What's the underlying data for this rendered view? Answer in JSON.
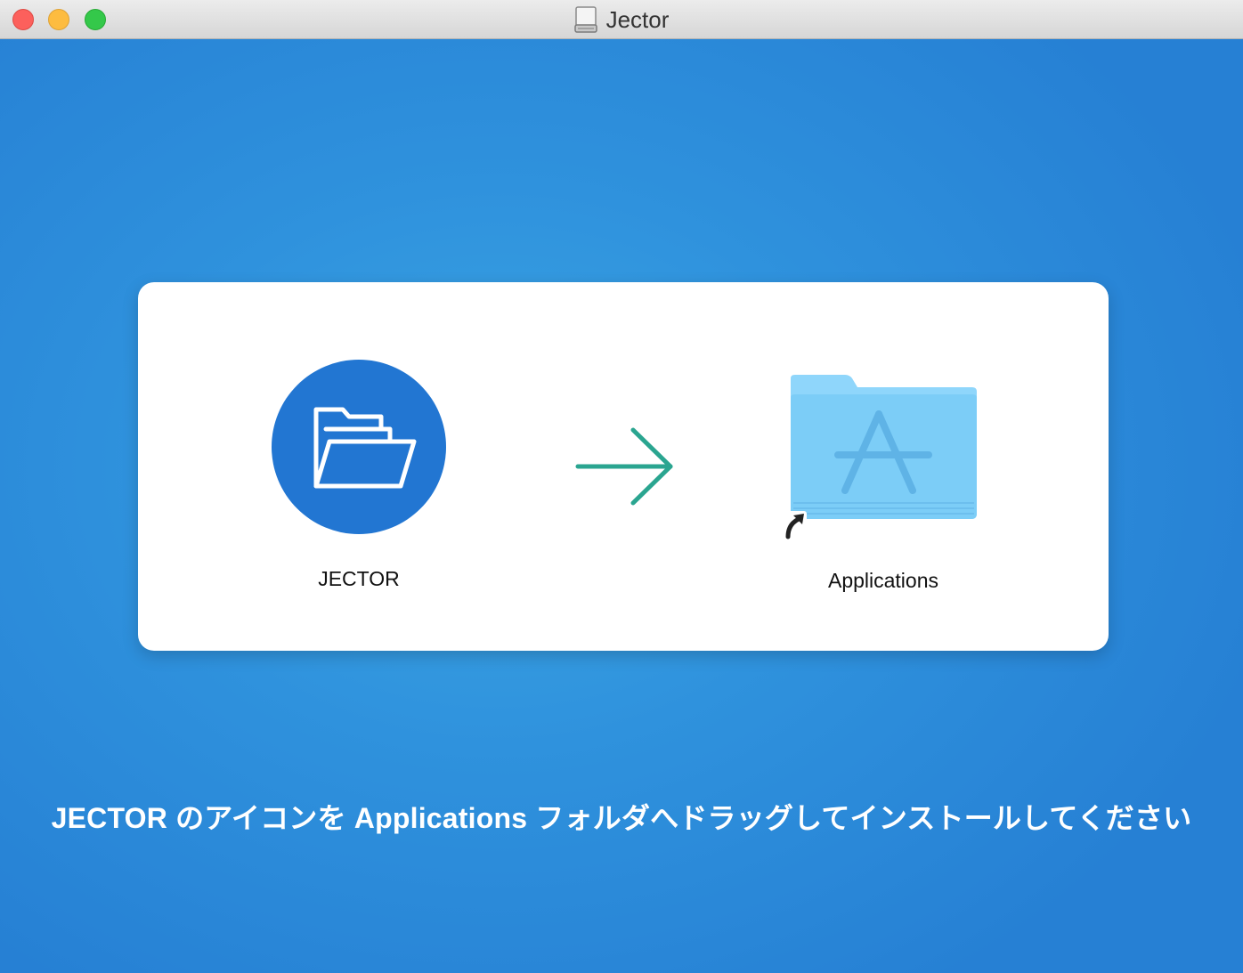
{
  "window": {
    "title": "Jector"
  },
  "installer": {
    "app_label": "JECTOR",
    "target_label": "Applications",
    "instruction": "JECTOR のアイコンを Applications フォルダへドラッグしてインストールしてください"
  },
  "colors": {
    "background": "#2a86d8",
    "app_icon_circle": "#2276d2",
    "arrow": "#2aa590",
    "folder": "#7ccdf7"
  },
  "icons": {
    "title_icon": "disk-drive-icon",
    "app_icon": "open-folder-icon",
    "arrow": "arrow-right-icon",
    "target": "applications-folder-icon",
    "alias_badge": "alias-arrow-icon"
  }
}
